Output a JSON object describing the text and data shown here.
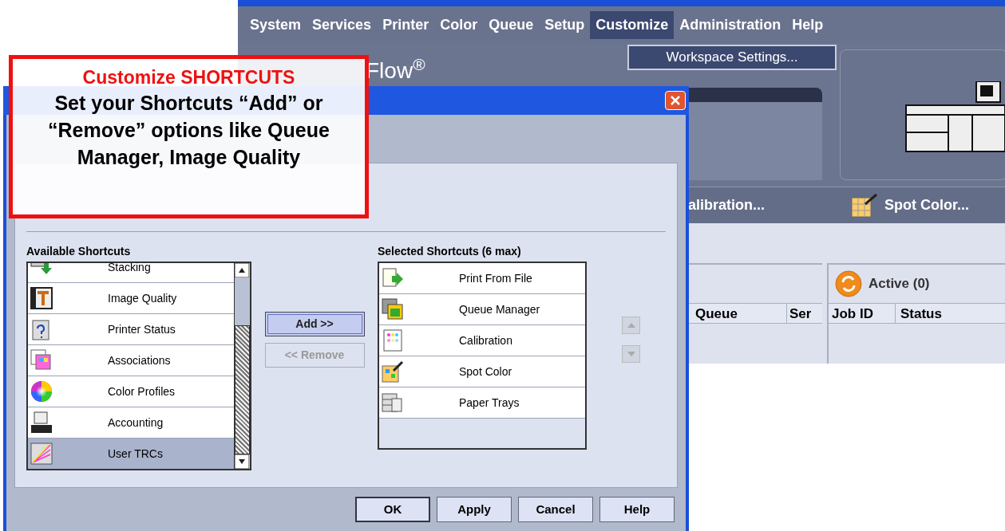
{
  "app_window": {
    "menu": [
      {
        "label": "System",
        "selected": false
      },
      {
        "label": "Services",
        "selected": false
      },
      {
        "label": "Printer",
        "selected": false
      },
      {
        "label": "Color",
        "selected": false
      },
      {
        "label": "Queue",
        "selected": false
      },
      {
        "label": "Setup",
        "selected": false
      },
      {
        "label": "Customize",
        "selected": true
      },
      {
        "label": "Administration",
        "selected": false
      },
      {
        "label": "Help",
        "selected": false
      }
    ],
    "open_menu": {
      "items": [
        "Workspace Settings..."
      ]
    },
    "logo_text": "Flow$^{®}$",
    "shortcut_bar": [
      {
        "label": "alibration..."
      },
      {
        "label": "Spot Color..."
      }
    ],
    "queue_table": {
      "columns": [
        "Queue",
        "Ser"
      ]
    },
    "active_panel": {
      "title": "Active (0)",
      "columns": [
        "Job ID",
        "Status"
      ]
    }
  },
  "dialog": {
    "available": {
      "label": "Available Shortcuts",
      "items": [
        {
          "label": "Stacking",
          "selected": false
        },
        {
          "label": "Image Quality",
          "selected": false
        },
        {
          "label": "Printer Status",
          "selected": false
        },
        {
          "label": "Associations",
          "selected": false
        },
        {
          "label": "Color Profiles",
          "selected": false
        },
        {
          "label": "Accounting",
          "selected": false
        },
        {
          "label": "User TRCs",
          "selected": true
        }
      ]
    },
    "add_button": {
      "label": "Add >>",
      "disabled": false
    },
    "remove_button": {
      "label": "<< Remove",
      "disabled": true
    },
    "selected": {
      "label": "Selected Shortcuts (6 max)",
      "items": [
        {
          "label": "Print From File",
          "selected": false
        },
        {
          "label": "Queue Manager",
          "selected": false
        },
        {
          "label": "Calibration",
          "selected": false
        },
        {
          "label": "Spot Color",
          "selected": false
        },
        {
          "label": "Paper Trays",
          "selected": false
        }
      ]
    },
    "buttons": [
      {
        "label": "OK",
        "default": true
      },
      {
        "label": "Apply",
        "default": false
      },
      {
        "label": "Cancel",
        "default": false
      },
      {
        "label": "Help",
        "default": false
      }
    ]
  },
  "callout": {
    "title": "Customize SHORTCUTS",
    "text": "Set your Shortcuts “Add” or “Remove” options like Queue Manager, Image Quality"
  }
}
